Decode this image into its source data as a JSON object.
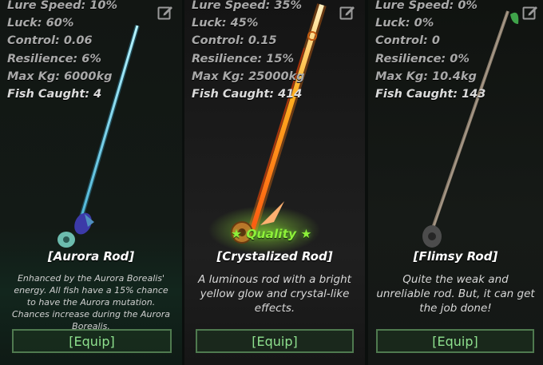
{
  "labels": {
    "lure_speed": "Lure Speed:",
    "luck": "Luck:",
    "control": "Control:",
    "resilience": "Resilience:",
    "max_kg": "Max Kg:",
    "fish_caught": "Fish Caught:"
  },
  "rods": [
    {
      "name": "[Aurora Rod]",
      "lure_speed": "10%",
      "luck": "60%",
      "control": "0.06",
      "resilience": "6%",
      "max_kg": "6000kg",
      "fish_caught": "4",
      "description": "Enhanced by the Aurora Borealis' energy. All fish have a 15% chance to have the Aurora mutation. Chances increase during the Aurora Borealis.",
      "equip_label": "[Equip]",
      "rod_color": "#7fe6ff"
    },
    {
      "name": "[Crystalized Rod]",
      "lure_speed": "35%",
      "luck": "45%",
      "control": "0.15",
      "resilience": "15%",
      "max_kg": "25000kg",
      "fish_caught": "414",
      "description": "A luminous rod with a bright yellow glow and crystal-like effects.",
      "equip_label": "[Equip]",
      "quality_label": "Quality",
      "quality_star": "★",
      "rod_color": "#ff9a1a"
    },
    {
      "name": "[Flimsy Rod]",
      "lure_speed": "0%",
      "luck": "0%",
      "control": "0",
      "resilience": "0%",
      "max_kg": "10.4kg",
      "fish_caught": "143",
      "description": "Quite the weak and unreliable rod. But, it can get the job done!",
      "equip_label": "[Equip]",
      "rod_color": "#9c8f80"
    }
  ],
  "colors": {
    "equip_text": "#8ee18e",
    "equip_border": "#4f7a4f",
    "quality_text": "#8ef03a",
    "stat_text": "#a9a9a9"
  },
  "icons": {
    "edit": "edit-icon",
    "star": "star-icon"
  }
}
